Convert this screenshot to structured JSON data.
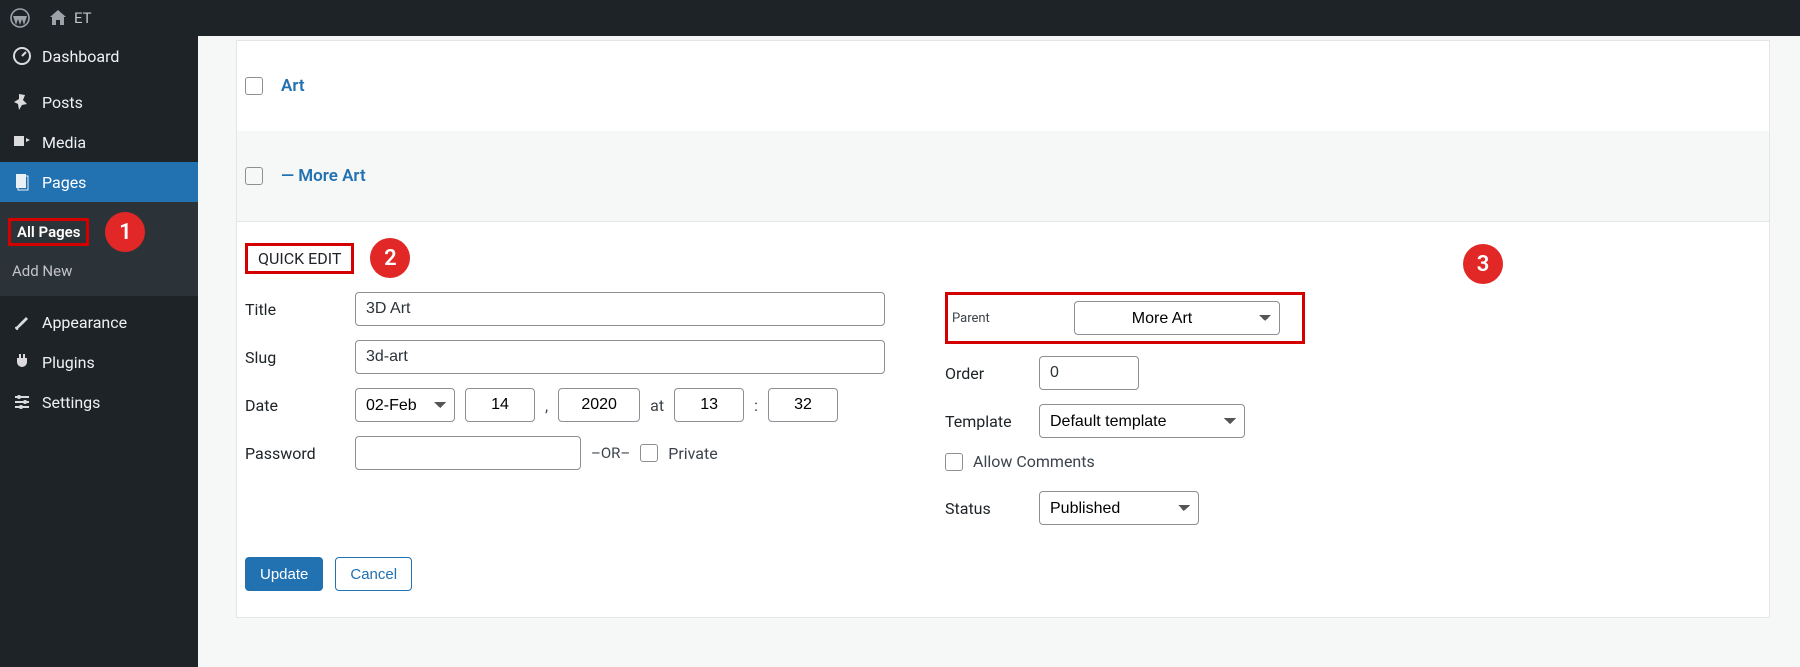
{
  "adminbar": {
    "site_name": "ET"
  },
  "sidebar": {
    "dashboard": "Dashboard",
    "posts": "Posts",
    "media": "Media",
    "pages": "Pages",
    "appearance": "Appearance",
    "plugins": "Plugins",
    "settings": "Settings",
    "submenu_all_pages": "All Pages",
    "submenu_add_new": "Add New"
  },
  "annotations": {
    "badge1": "1",
    "badge2": "2",
    "badge3": "3"
  },
  "list": {
    "rows": [
      {
        "title": "Art"
      },
      {
        "title": "— More Art"
      }
    ]
  },
  "quick_edit": {
    "heading": "QUICK EDIT",
    "labels": {
      "title": "Title",
      "slug": "Slug",
      "date": "Date",
      "password": "Password",
      "or": "–OR–",
      "private": "Private",
      "parent": "Parent",
      "order": "Order",
      "template": "Template",
      "allow_comments": "Allow Comments",
      "status": "Status",
      "at": "at"
    },
    "values": {
      "title": "3D Art",
      "slug": "3d-art",
      "month": "02-Feb",
      "day": "14",
      "year": "2020",
      "hour": "13",
      "minute": "32",
      "password": "",
      "private": false,
      "parent": "More Art",
      "order": "0",
      "template": "Default template",
      "allow_comments": false,
      "status": "Published"
    },
    "buttons": {
      "update": "Update",
      "cancel": "Cancel"
    }
  }
}
